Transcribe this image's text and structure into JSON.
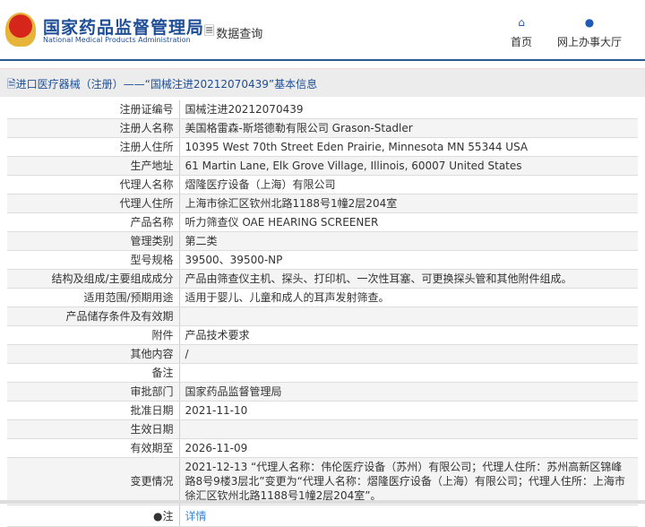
{
  "header": {
    "logo_cn": "国家药品监督管理局",
    "logo_en": "National Medical Products Administration",
    "data_query": "数据查询",
    "nav": [
      {
        "label": "首页",
        "icon": "home-icon"
      },
      {
        "label": "网上办事大厅",
        "icon": "user-icon"
      }
    ]
  },
  "breadcrumb": "进口医疗器械（注册）——“国械注进20212070439”基本信息",
  "rows": [
    {
      "label": "注册证编号",
      "value": "国械注进20212070439"
    },
    {
      "label": "注册人名称",
      "value": "美国格雷森-斯塔德勒有限公司 Grason-Stadler"
    },
    {
      "label": "注册人住所",
      "value": "10395 West 70th Street Eden Prairie, Minnesota MN 55344 USA"
    },
    {
      "label": "生产地址",
      "value": "61 Martin Lane, Elk Grove Village, Illinois, 60007 United States"
    },
    {
      "label": "代理人名称",
      "value": "熠隆医疗设备（上海）有限公司"
    },
    {
      "label": "代理人住所",
      "value": "上海市徐汇区钦州北路1188号1幢2层204室"
    },
    {
      "label": "产品名称",
      "value": "听力筛查仪 OAE HEARING SCREENER"
    },
    {
      "label": "管理类别",
      "value": "第二类"
    },
    {
      "label": "型号规格",
      "value": "39500、39500-NP"
    },
    {
      "label": "结构及组成/主要组成成分",
      "value": "产品由筛查仪主机、探头、打印机、一次性耳塞、可更换探头管和其他附件组成。"
    },
    {
      "label": "适用范围/预期用途",
      "value": "适用于婴儿、儿童和成人的耳声发射筛查。"
    },
    {
      "label": "产品储存条件及有效期",
      "value": ""
    },
    {
      "label": "附件",
      "value": "产品技术要求"
    },
    {
      "label": "其他内容",
      "value": "/"
    },
    {
      "label": "备注",
      "value": ""
    },
    {
      "label": "审批部门",
      "value": "国家药品监督管理局"
    },
    {
      "label": "批准日期",
      "value": "2021-11-10"
    },
    {
      "label": "生效日期",
      "value": ""
    },
    {
      "label": "有效期至",
      "value": "2026-11-09"
    },
    {
      "label": "变更情况",
      "value": "2021-12-13 “代理人名称：伟伦医疗设备（苏州）有限公司；代理人住所：苏州高新区锦峰路8号9楼3层北”变更为“代理人名称：熠隆医疗设备（上海）有限公司；代理人住所：上海市徐汇区钦州北路1188号1幢2层204室”。"
    }
  ],
  "note": {
    "label": "注",
    "link": "详情"
  }
}
